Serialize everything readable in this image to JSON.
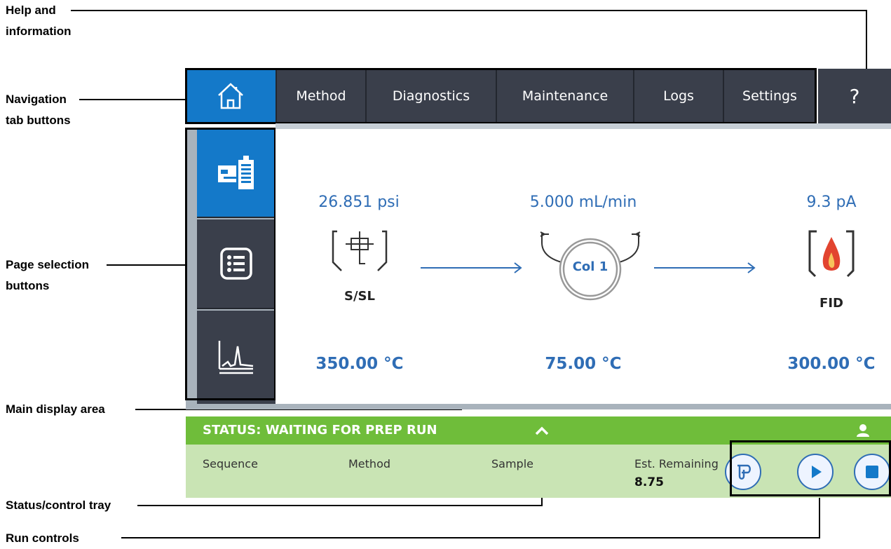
{
  "callouts": {
    "help_line1": "Help and",
    "help_line2": "information",
    "nav_line1": "Navigation",
    "nav_line2": "tab buttons",
    "page_line1": "Page selection",
    "page_line2": "buttons",
    "main_display": "Main display area",
    "status_tray": "Status/control tray",
    "run_controls": "Run controls"
  },
  "nav": {
    "home_icon": "home-icon",
    "tabs": [
      "Method",
      "Diagnostics",
      "Maintenance",
      "Logs",
      "Settings"
    ],
    "help": "?"
  },
  "side": {
    "buttons": [
      "instrument-icon",
      "list-icon",
      "chromatogram-icon"
    ],
    "active_index": 0
  },
  "flow": {
    "inlet": {
      "reading": "26.851 psi",
      "label": "S/SL",
      "temp": "350.00 °C"
    },
    "column": {
      "reading": "5.000 mL/min",
      "label": "Col 1",
      "temp": "75.00 °C"
    },
    "detector": {
      "reading": "9.3 pA",
      "label": "FID",
      "temp": "300.00 °C"
    }
  },
  "status": {
    "text": "STATUS: WAITING FOR PREP RUN",
    "toggle_icon": "chevron-up-icon",
    "user_icon": "user-icon",
    "columns": {
      "sequence": "Sequence",
      "method": "Method",
      "sample": "Sample",
      "remaining": "Est. Remaining",
      "remaining_value": "8.75"
    }
  },
  "run_controls": [
    "prep-run-icon",
    "start-icon",
    "stop-icon"
  ],
  "colors": {
    "accent_blue": "#1479c9",
    "nav_dark": "#3a3f4b",
    "status_green": "#6fbd3a",
    "status_tray": "#c9e4b4",
    "value_blue": "#2f6db5"
  }
}
